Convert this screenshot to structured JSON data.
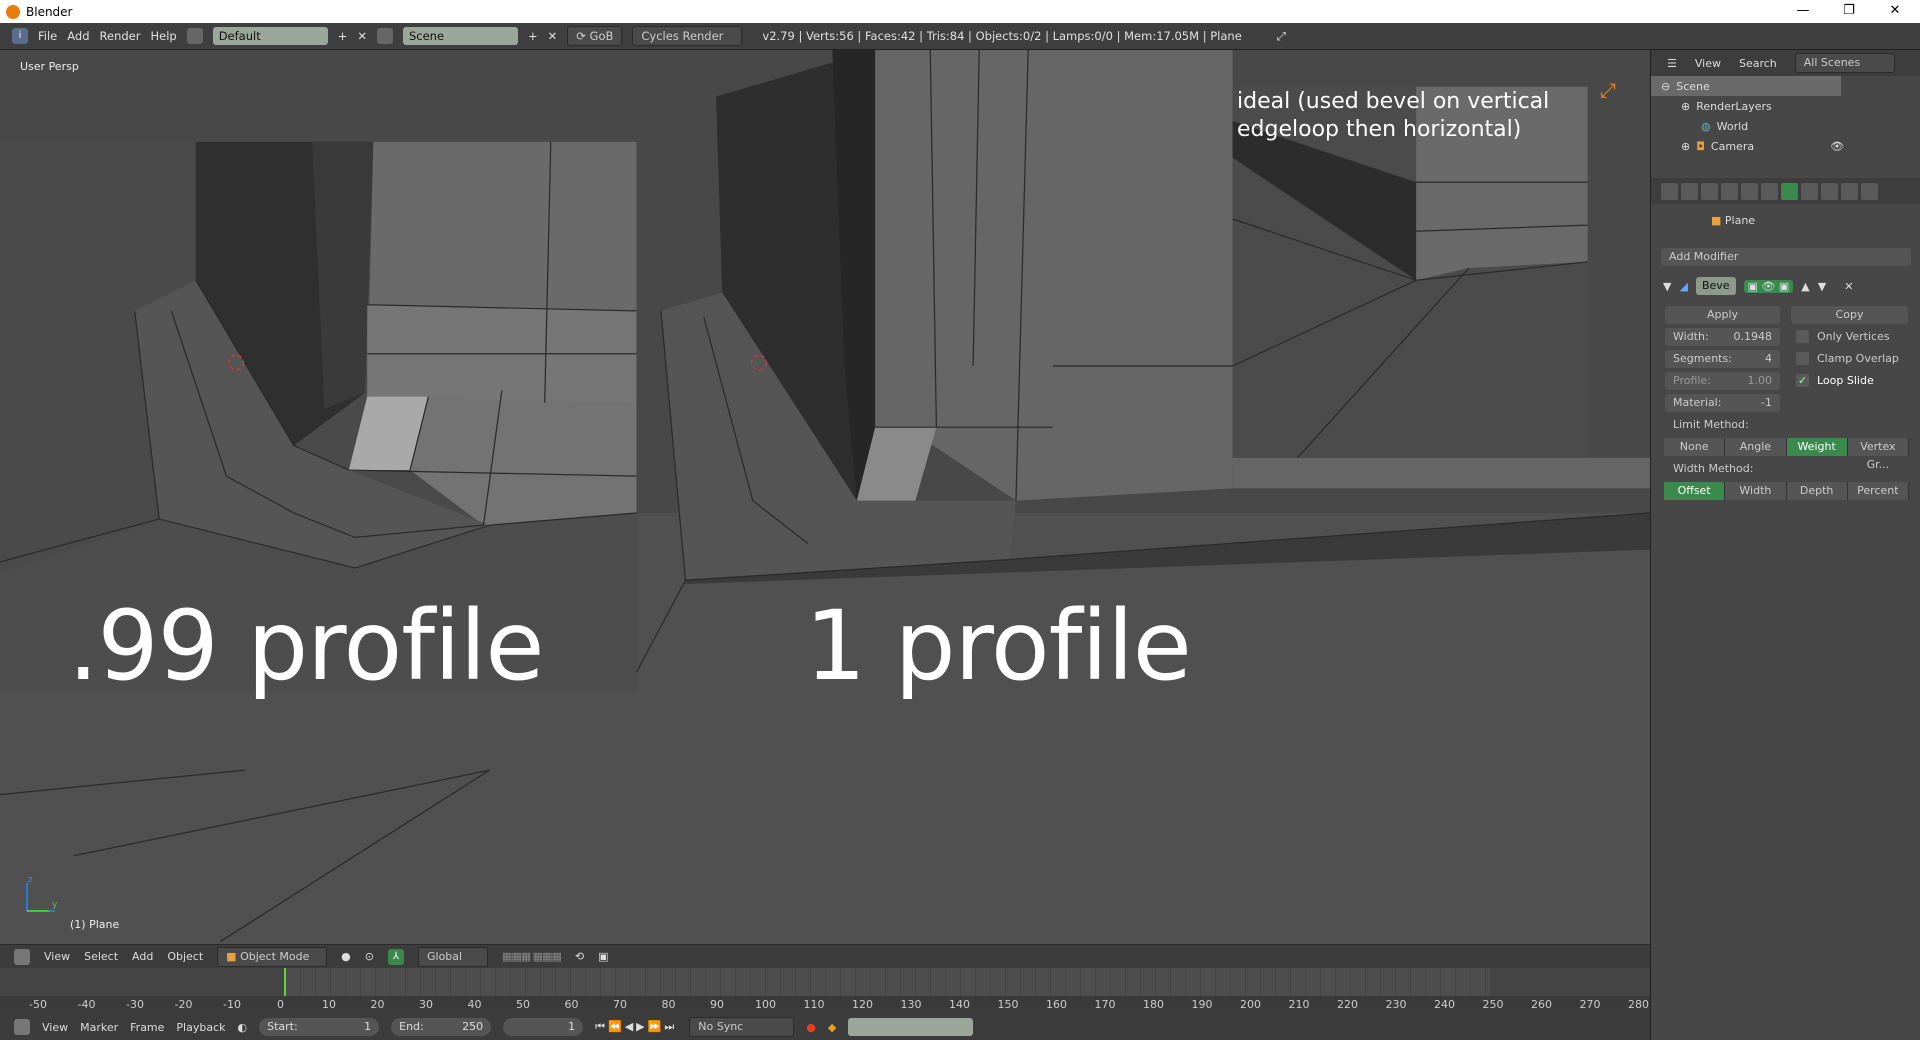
{
  "window": {
    "title": "Blender",
    "minimize": "—",
    "maximize": "❐",
    "close": "✕"
  },
  "info_header": {
    "menus": [
      "File",
      "Add",
      "Render",
      "Help"
    ],
    "layout": "Default",
    "scene": "Scene",
    "gob": "GoB",
    "engine": "Cycles Render",
    "stats": "v2.79 | Verts:56 | Faces:42 | Tris:84 | Objects:0/2 | Lamps:0/0 | Mem:17.05M | Plane"
  },
  "viewport": {
    "view_name": "User Persp",
    "object_label": "(1) Plane",
    "left_caption": ".99 profile",
    "right_caption": "1 profile",
    "inset_caption": "ideal (used bevel on vertical edgeloop then horizontal)",
    "axis_z": "z",
    "axis_y": "y"
  },
  "view3d_header": {
    "menus": [
      "View",
      "Select",
      "Add",
      "Object"
    ],
    "mode": "Object Mode",
    "orientation": "Global"
  },
  "timeline": {
    "ticks": [
      "-50",
      "-40",
      "-30",
      "-20",
      "-10",
      "0",
      "10",
      "20",
      "30",
      "40",
      "50",
      "60",
      "70",
      "80",
      "90",
      "100",
      "110",
      "120",
      "130",
      "140",
      "150",
      "160",
      "170",
      "180",
      "190",
      "200",
      "210",
      "220",
      "230",
      "240",
      "250",
      "260",
      "270",
      "280"
    ],
    "current_frame": "1",
    "start_label": "Start:",
    "start": "1",
    "end_label": "End:",
    "end": "250",
    "menus": [
      "View",
      "Marker",
      "Frame",
      "Playback"
    ],
    "sync": "No Sync"
  },
  "outliner": {
    "menus": [
      "View",
      "Search"
    ],
    "filter": "All Scenes",
    "items": [
      "Scene",
      "RenderLayers",
      "World",
      "Camera"
    ]
  },
  "properties": {
    "context": "Plane",
    "add_modifier": "Add Modifier",
    "modifier_name": "Beve",
    "apply": "Apply",
    "copy": "Copy",
    "fields": [
      {
        "label": "Width:",
        "value": "0.1948"
      },
      {
        "label": "Segments:",
        "value": "4"
      },
      {
        "label": "Profile:",
        "value": "1.00"
      },
      {
        "label": "Material:",
        "value": "-1"
      }
    ],
    "checkboxes": [
      {
        "label": "Only Vertices",
        "checked": false
      },
      {
        "label": "Clamp Overlap",
        "checked": false
      },
      {
        "label": "Loop Slide",
        "checked": true
      }
    ],
    "limit_method_label": "Limit Method:",
    "limit_methods": [
      "None",
      "Angle",
      "Weight",
      "Vertex Gr..."
    ],
    "limit_selected": "Weight",
    "width_method_label": "Width Method:",
    "width_methods": [
      "Offset",
      "Width",
      "Depth",
      "Percent"
    ],
    "width_selected": "Offset"
  },
  "colors": {
    "accent_green": "#3b8a4d",
    "timeline_cursor": "#5fd33a",
    "orange": "#e87d0d"
  }
}
